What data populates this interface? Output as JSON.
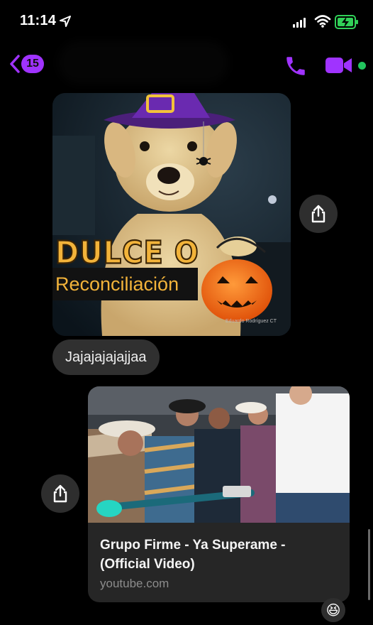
{
  "status_bar": {
    "time": "11:14"
  },
  "header": {
    "back_badge": "15",
    "icons": [
      "chevron-left-icon",
      "phone-icon",
      "video-camera-icon"
    ],
    "accent_color": "#a033ff",
    "online_color": "#22c55e"
  },
  "messages": {
    "meme": {
      "headline": "DULCE O",
      "caption": "Reconciliación",
      "watermark": "Eduardo Rodríguez CT"
    },
    "text_bubble": "Jajajajajajjaa",
    "link_preview": {
      "title": "Grupo Firme - Ya Superame - (Official Video)",
      "domain": "youtube.com"
    },
    "reaction": "😆"
  }
}
